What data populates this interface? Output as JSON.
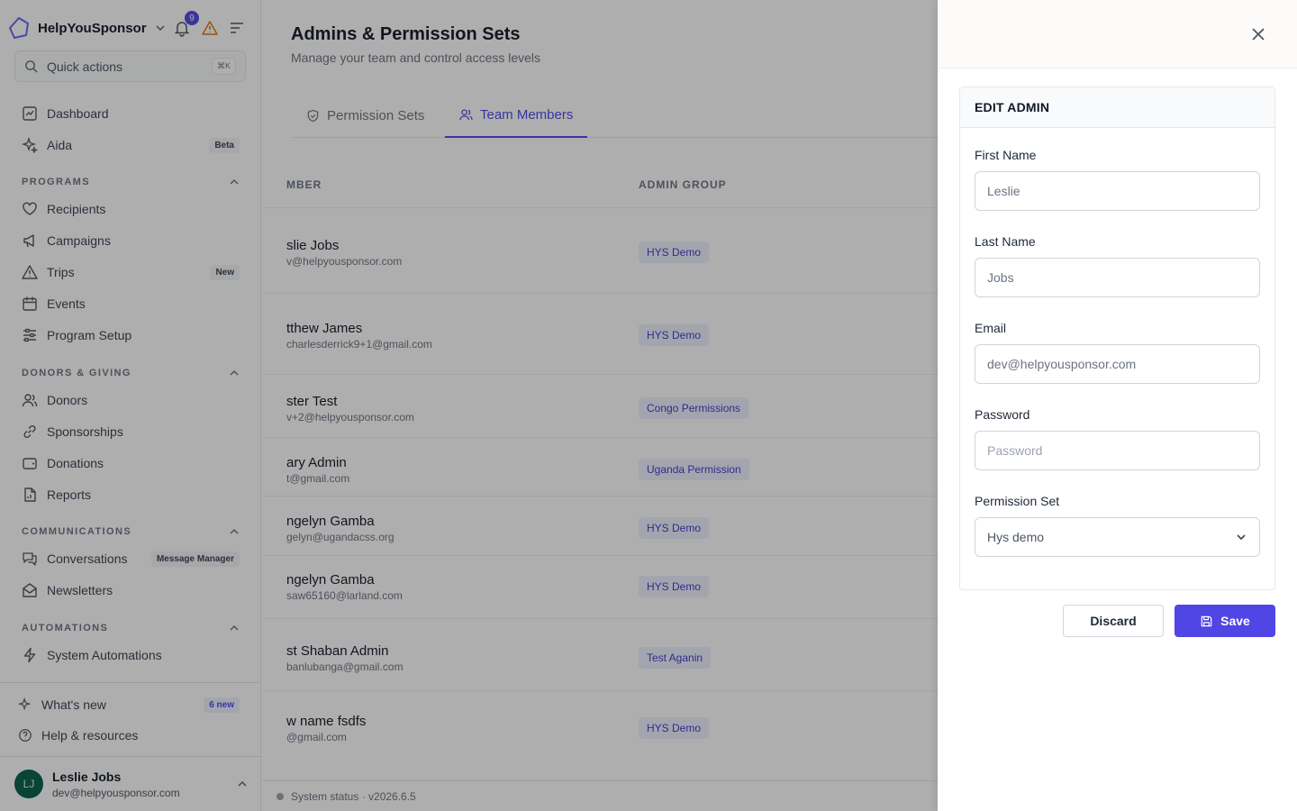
{
  "sidebar": {
    "org_name": "HelpYouSponsor",
    "notification_count": "9",
    "quick_actions": {
      "label": "Quick actions",
      "shortcut": "⌘K"
    },
    "top_items": [
      {
        "label": "Dashboard",
        "icon": "dashboard-icon"
      },
      {
        "label": "Aida",
        "icon": "sparkles-icon",
        "badge": "Beta"
      }
    ],
    "sections": [
      {
        "title": "PROGRAMS",
        "items": [
          {
            "label": "Recipients",
            "icon": "heart-icon"
          },
          {
            "label": "Campaigns",
            "icon": "megaphone-icon"
          },
          {
            "label": "Trips",
            "icon": "triangle-icon",
            "badge": "New"
          },
          {
            "label": "Events",
            "icon": "calendar-icon"
          },
          {
            "label": "Program Setup",
            "icon": "sliders-icon"
          }
        ]
      },
      {
        "title": "DONORS & GIVING",
        "items": [
          {
            "label": "Donors",
            "icon": "users-icon"
          },
          {
            "label": "Sponsorships",
            "icon": "link-icon"
          },
          {
            "label": "Donations",
            "icon": "wallet-icon"
          },
          {
            "label": "Reports",
            "icon": "report-icon"
          }
        ]
      },
      {
        "title": "COMMUNICATIONS",
        "items": [
          {
            "label": "Conversations",
            "icon": "chat-icon",
            "badge": "Message Manager"
          },
          {
            "label": "Newsletters",
            "icon": "envelope-icon"
          }
        ]
      },
      {
        "title": "AUTOMATIONS",
        "items": [
          {
            "label": "System Automations",
            "icon": "bolt-icon"
          }
        ]
      }
    ],
    "footer_items": [
      {
        "label": "What's new",
        "icon": "sparkles-icon",
        "badge": "6 new"
      },
      {
        "label": "Help & resources",
        "icon": "help-icon"
      }
    ],
    "user": {
      "initials": "LJ",
      "name": "Leslie Jobs",
      "email": "dev@helpyousponsor.com"
    }
  },
  "main": {
    "title": "Admins & Permission Sets",
    "subtitle": "Manage your team and control access levels",
    "tabs": [
      {
        "label": "Permission Sets",
        "icon": "shield-icon",
        "active": false
      },
      {
        "label": "Team Members",
        "icon": "users-icon",
        "active": true
      }
    ],
    "columns": [
      "MBER",
      "ADMIN GROUP"
    ],
    "rows": [
      {
        "name": "slie Jobs",
        "email": "v@helpyousponsor.com",
        "group": "HYS Demo"
      },
      {
        "name": "tthew James",
        "email": "charlesderrick9+1@gmail.com",
        "group": "HYS Demo"
      },
      {
        "name": "ster Test",
        "email": "v+2@helpyousponsor.com",
        "group": "Congo Permissions"
      },
      {
        "name": "ary Admin",
        "email": "t@gmail.com",
        "group": "Uganda Permission"
      },
      {
        "name": "ngelyn Gamba",
        "email": "gelyn@ugandacss.org",
        "group": "HYS Demo"
      },
      {
        "name": "ngelyn Gamba",
        "email": "saw65160@larland.com",
        "group": "HYS Demo"
      },
      {
        "name": "st Shaban Admin",
        "email": "banlubanga@gmail.com",
        "group": "Test Aganin"
      },
      {
        "name": "w name fsdfs",
        "email": "@gmail.com",
        "group": "HYS Demo"
      }
    ],
    "footer": "System status · v2026.6.5"
  },
  "drawer": {
    "card_title": "EDIT ADMIN",
    "fields": {
      "first_name": {
        "label": "First Name",
        "value": "Leslie"
      },
      "last_name": {
        "label": "Last Name",
        "value": "Jobs"
      },
      "email": {
        "label": "Email",
        "value": "dev@helpyousponsor.com"
      },
      "password": {
        "label": "Password",
        "placeholder": "Password"
      },
      "permission_set": {
        "label": "Permission Set",
        "value": "Hys demo"
      }
    },
    "discard_label": "Discard",
    "save_label": "Save"
  },
  "colors": {
    "accent": "#4f46e5",
    "warning": "#d97706",
    "avatar": "#065f46"
  }
}
